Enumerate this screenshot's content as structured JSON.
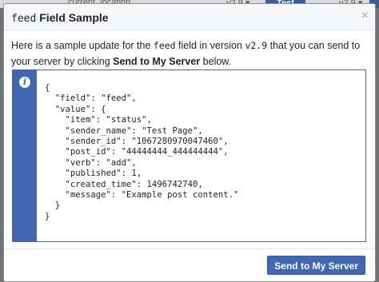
{
  "background": {
    "label": "current_location",
    "version": "v2.9 ▾",
    "button": "Test",
    "version2": "v2.9 ▾"
  },
  "dialog": {
    "title_code": "feed",
    "title_rest": " Field Sample",
    "close_glyph": "×",
    "intro_part1": "Here is a sample update for the ",
    "intro_code1": "feed",
    "intro_part2": " field in version ",
    "intro_code2": "v2.9",
    "intro_part3": " that you can send to your server by clicking ",
    "intro_bold": "Send to My Server",
    "intro_part4": " below.",
    "info_icon": "info-icon",
    "code": "{\n  \"field\": \"feed\",\n  \"value\": {\n    \"item\": \"status\",\n    \"sender_name\": \"Test Page\",\n    \"sender_id\": \"1067280970047460\",\n    \"post_id\": \"44444444_444444444\",\n    \"verb\": \"add\",\n    \"published\": 1,\n    \"created_time\": 1496742740,\n    \"message\": \"Example post content.\"\n  }\n}",
    "send_button": "Send to My Server"
  },
  "colors": {
    "accent": "#4267b2",
    "header_bg": "#f6f7f9",
    "overlay": "#6f7277"
  }
}
